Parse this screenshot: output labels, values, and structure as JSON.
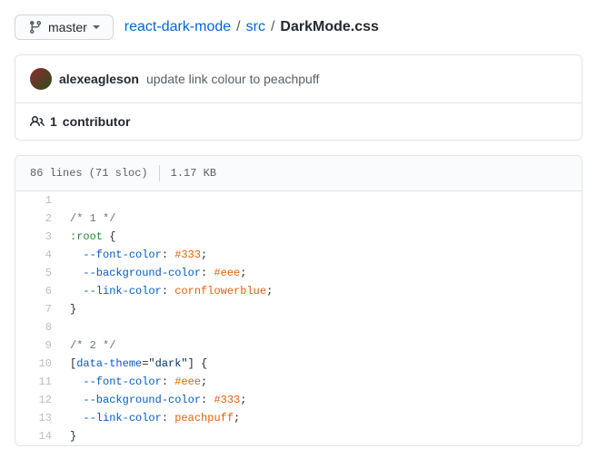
{
  "branch": "master",
  "breadcrumb": {
    "repo": "react-dark-mode",
    "folder": "src",
    "file": "DarkMode.css"
  },
  "commit": {
    "author": "alexeagleson",
    "message": "update link colour to peachpuff"
  },
  "contributors": {
    "count": "1",
    "label": "contributor"
  },
  "fileInfo": {
    "lines": "86 lines (71 sloc)",
    "size": "1.17 KB"
  },
  "code": [
    {
      "n": 1,
      "tokens": []
    },
    {
      "n": 2,
      "tokens": [
        {
          "t": "/* 1 */",
          "c": "pl-c"
        }
      ]
    },
    {
      "n": 3,
      "tokens": [
        {
          "t": ":root",
          "c": "pl-ent"
        },
        {
          "t": " {",
          "c": ""
        }
      ]
    },
    {
      "n": 4,
      "tokens": [
        {
          "t": "  ",
          "c": ""
        },
        {
          "t": "--font-color",
          "c": "pl-c1"
        },
        {
          "t": ": ",
          "c": ""
        },
        {
          "t": "#333",
          "c": "pl-v"
        },
        {
          "t": ";",
          "c": ""
        }
      ]
    },
    {
      "n": 5,
      "tokens": [
        {
          "t": "  ",
          "c": ""
        },
        {
          "t": "--background-color",
          "c": "pl-c1"
        },
        {
          "t": ": ",
          "c": ""
        },
        {
          "t": "#eee",
          "c": "pl-v"
        },
        {
          "t": ";",
          "c": ""
        }
      ]
    },
    {
      "n": 6,
      "tokens": [
        {
          "t": "  ",
          "c": ""
        },
        {
          "t": "--link-color",
          "c": "pl-c1"
        },
        {
          "t": ": ",
          "c": ""
        },
        {
          "t": "cornflowerblue",
          "c": "pl-v"
        },
        {
          "t": ";",
          "c": ""
        }
      ]
    },
    {
      "n": 7,
      "tokens": [
        {
          "t": "}",
          "c": ""
        }
      ]
    },
    {
      "n": 8,
      "tokens": []
    },
    {
      "n": 9,
      "tokens": [
        {
          "t": "/* 2 */",
          "c": "pl-c"
        }
      ]
    },
    {
      "n": 10,
      "tokens": [
        {
          "t": "[",
          "c": ""
        },
        {
          "t": "data-theme",
          "c": "pl-c1"
        },
        {
          "t": "=",
          "c": ""
        },
        {
          "t": "\"dark\"",
          "c": "pl-s"
        },
        {
          "t": "] {",
          "c": ""
        }
      ]
    },
    {
      "n": 11,
      "tokens": [
        {
          "t": "  ",
          "c": ""
        },
        {
          "t": "--font-color",
          "c": "pl-c1"
        },
        {
          "t": ": ",
          "c": ""
        },
        {
          "t": "#eee",
          "c": "pl-v"
        },
        {
          "t": ";",
          "c": ""
        }
      ]
    },
    {
      "n": 12,
      "tokens": [
        {
          "t": "  ",
          "c": ""
        },
        {
          "t": "--background-color",
          "c": "pl-c1"
        },
        {
          "t": ": ",
          "c": ""
        },
        {
          "t": "#333",
          "c": "pl-v"
        },
        {
          "t": ";",
          "c": ""
        }
      ]
    },
    {
      "n": 13,
      "tokens": [
        {
          "t": "  ",
          "c": ""
        },
        {
          "t": "--link-color",
          "c": "pl-c1"
        },
        {
          "t": ": ",
          "c": ""
        },
        {
          "t": "peachpuff",
          "c": "pl-v"
        },
        {
          "t": ";",
          "c": ""
        }
      ]
    },
    {
      "n": 14,
      "tokens": [
        {
          "t": "}",
          "c": ""
        }
      ]
    }
  ]
}
